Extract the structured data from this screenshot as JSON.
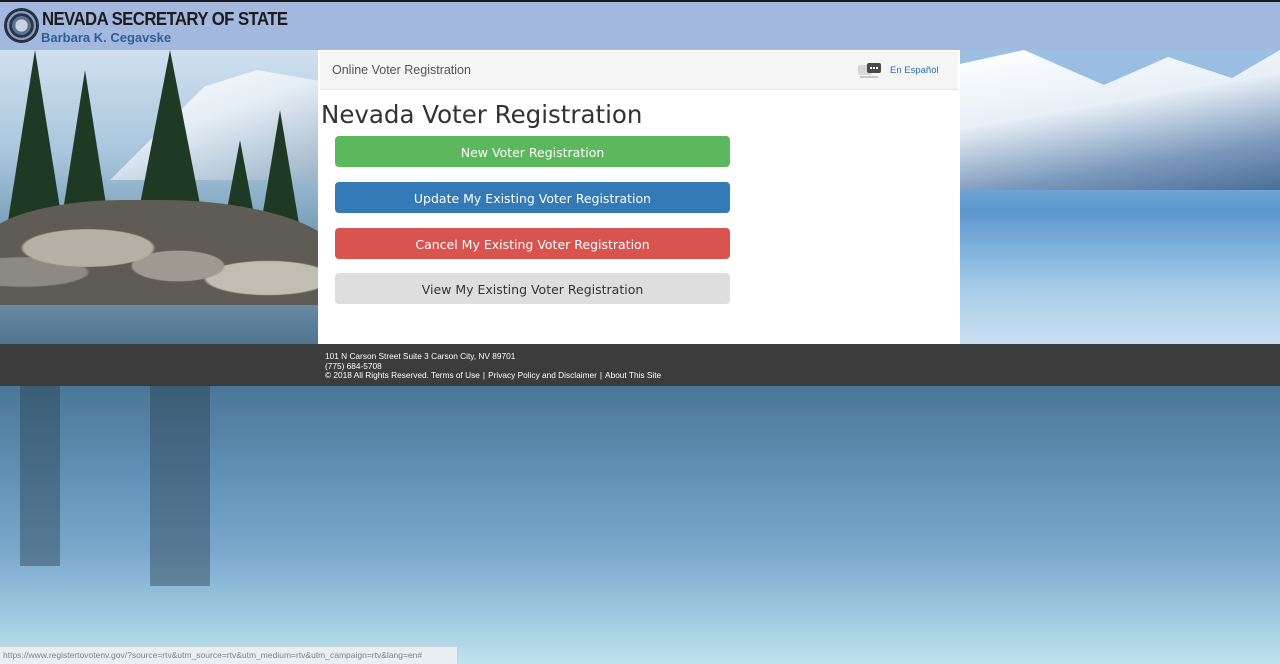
{
  "header": {
    "agency": "NEVADA SECRETARY OF STATE",
    "secretary": "Barbara K. Cegavske"
  },
  "panel": {
    "breadcrumb": "Online Voter Registration",
    "language_link": "En Español",
    "page_title": "Nevada Voter Registration",
    "buttons": {
      "new": "New Voter Registration",
      "update": "Update My Existing Voter Registration",
      "cancel": "Cancel My Existing Voter Registration",
      "view": "View My Existing Voter Registration"
    }
  },
  "footer": {
    "address": "101 N Carson Street Suite 3 Carson City, NV 89701",
    "phone": "(775) 684-5708",
    "copyright": "© 2018 All Rights Reserved.",
    "terms": "Terms of Use",
    "privacy": "Privacy Policy and Disclaimer",
    "about": "About This Site"
  },
  "status_bar": {
    "url": "https://www.registertovotenv.gov/?source=rtv&utm_source=rtv&utm_medium=rtv&utm_campaign=rtv&lang=en#"
  },
  "colors": {
    "header_bg": "#a3b8de",
    "new_btn": "#5cb85c",
    "update_btn": "#337ab7",
    "cancel_btn": "#d9534f",
    "view_btn": "#dedede",
    "footer_bg": "#3c3c3c"
  }
}
